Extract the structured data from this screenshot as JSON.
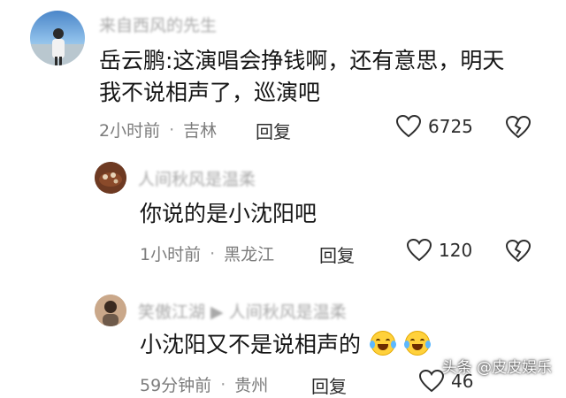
{
  "comments": [
    {
      "author": "来自西风的先生",
      "text_lines": [
        "岳云鹏:这演唱会挣钱啊，还有意思，明天",
        "我不说相声了，巡演吧"
      ],
      "time": "2小时前",
      "location": "吉林",
      "reply_label": "回复",
      "likes": "6725"
    },
    {
      "author": "人间秋风是温柔",
      "text_lines": [
        "你说的是小沈阳吧"
      ],
      "time": "1小时前",
      "location": "黑龙江",
      "reply_label": "回复",
      "likes": "120"
    },
    {
      "author": "笑傲江湖 ▶ 人间秋风是温柔",
      "text_lines": [
        "小沈阳又不是说相声的"
      ],
      "emoji_count_icons": [
        "laughing-crying-emoji",
        "laughing-crying-emoji"
      ],
      "time": "59分钟前",
      "location": "贵州",
      "reply_label": "回复",
      "likes": "46"
    }
  ],
  "watermark": "头条 @皮皮娱乐",
  "icons": {
    "like": "heart-outline-icon",
    "dislike": "broken-heart-icon"
  },
  "colors": {
    "text": "#151515",
    "meta": "#7c7c7c",
    "author": "#a9a9a9"
  }
}
